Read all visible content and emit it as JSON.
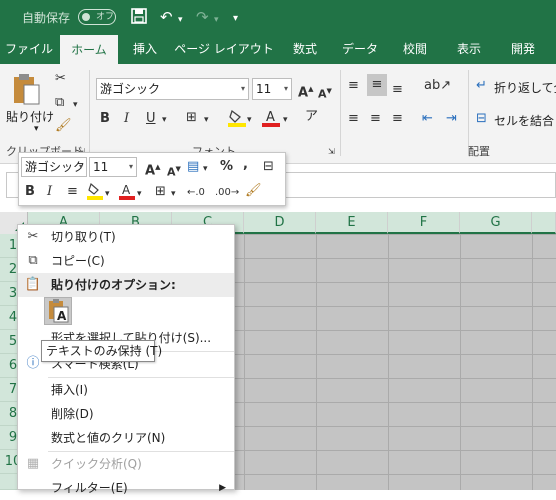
{
  "titlebar": {
    "autosave_label": "自動保存",
    "autosave_toggle": "オフ"
  },
  "tabs": [
    {
      "label": "ファイル"
    },
    {
      "label": "ホーム"
    },
    {
      "label": "挿入"
    },
    {
      "label": "ページ レイアウト"
    },
    {
      "label": "数式"
    },
    {
      "label": "データ"
    },
    {
      "label": "校閲"
    },
    {
      "label": "表示"
    },
    {
      "label": "開発"
    }
  ],
  "ribbon": {
    "paste_label": "貼り付け",
    "clipboard_group": "クリップボード",
    "font_name": "游ゴシック",
    "font_size": "11",
    "font_group": "フォント",
    "wrap_text": "折り返して全",
    "merge_center": "セルを結合し",
    "alignment_group": "配置"
  },
  "mini_toolbar": {
    "font_name": "游ゴシック",
    "font_size": "11",
    "percent": "%",
    "comma": ","
  },
  "columns": [
    "A",
    "B",
    "C",
    "D",
    "E",
    "F",
    "G"
  ],
  "rows": [
    "1",
    "2",
    "3",
    "4",
    "5",
    "6",
    "7",
    "8",
    "9",
    "10"
  ],
  "context_menu": {
    "cut": "切り取り(T)",
    "copy": "コピー(C)",
    "paste_options": "貼り付けのオプション:",
    "paste_option_glyph": "A",
    "paste_special": "形式を選択して貼り付け(S)...",
    "smart_lookup": "スマート検索(L)",
    "insert": "挿入(I)",
    "delete": "削除(D)",
    "clear_contents": "数式と値のクリア(N)",
    "quick_analysis": "クイック分析(Q)",
    "filter": "フィルター(E)"
  },
  "tooltip": "テキストのみ保持 (T)",
  "colors": {
    "excel_green": "#217346",
    "font_color_red": "#e02020",
    "fill_color_yellow": "#ffe600",
    "grid_gray": "#c4c4c4"
  }
}
